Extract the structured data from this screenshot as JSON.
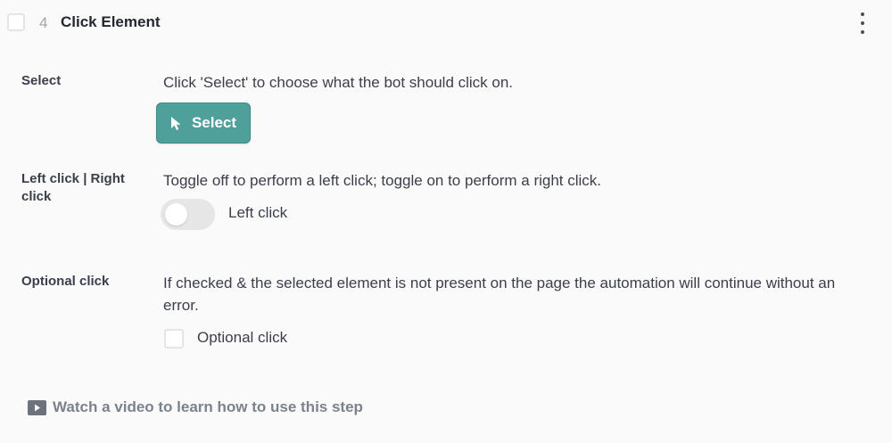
{
  "step": {
    "number": "4",
    "title": "Click Element"
  },
  "select_row": {
    "label": "Select",
    "description": "Click 'Select' to choose what the bot should click on.",
    "button_label": "Select"
  },
  "click_row": {
    "label": "Left click | Right click",
    "description": "Toggle off to perform a left click; toggle on to perform a right click.",
    "toggle_label": "Left click",
    "toggle_on": false
  },
  "optional_row": {
    "label": "Optional click",
    "description": "If checked & the selected element is not present on the page the automation will continue without an error.",
    "checkbox_label": "Optional click",
    "checked": false
  },
  "footer": {
    "video_link": "Watch a video to learn how to use this step"
  },
  "colors": {
    "accent": "#4f9f9b",
    "text": "#3a3f4a",
    "muted": "#7c828c",
    "background": "#fafafa"
  },
  "icons": {
    "menu": "kebab-menu-icon",
    "cursor": "cursor-pointer-icon",
    "video": "video-play-icon"
  }
}
